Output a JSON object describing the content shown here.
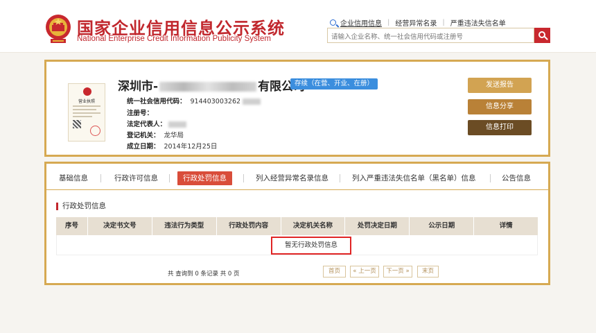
{
  "site": {
    "title": "国家企业信用信息公示系统",
    "subtitle": "National Enterprise Credit Information Publicity System"
  },
  "topnav": {
    "items": [
      "企业信用信息",
      "经营异常名录",
      "严重违法失信名单"
    ]
  },
  "search": {
    "placeholder": "请输入企业名称、统一社会信用代码或注册号"
  },
  "company": {
    "name_prefix": "深圳市-",
    "name_suffix": "有限公司",
    "status": "存续（在营、开业、在册）",
    "license_label": "营业执照",
    "fields": {
      "credit_code_label": "统一社会信用代码：",
      "credit_code_value": "914403003262",
      "reg_no_label": "注册号：",
      "reg_no_value": "",
      "legal_rep_label": "法定代表人：",
      "authority_label": "登记机关：",
      "authority_value": "龙华局",
      "est_date_label": "成立日期：",
      "est_date_value": "2014年12月25日"
    }
  },
  "actions": {
    "report": "发送报告",
    "share": "信息分享",
    "print": "信息打印"
  },
  "tabs": [
    "基础信息",
    "行政许可信息",
    "行政处罚信息",
    "列入经营异常名录信息",
    "列入严重违法失信名单（黑名单）信息",
    "公告信息"
  ],
  "active_tab": "行政处罚信息",
  "section": {
    "title": "行政处罚信息"
  },
  "table": {
    "columns": [
      "序号",
      "决定书文号",
      "违法行为类型",
      "行政处罚内容",
      "决定机关名称",
      "处罚决定日期",
      "公示日期",
      "详情"
    ],
    "empty_message": "暂无行政处罚信息"
  },
  "pager": {
    "info": "共 查询到 0 条记录 共 0 页",
    "first": "首页",
    "prev": "« 上一页",
    "next": "下一页 »",
    "last": "末页"
  },
  "colors": {
    "brand_red": "#c1272d",
    "gold_border": "#d6a952",
    "status_blue": "#3b8ede",
    "active_tab": "#d94d3a"
  }
}
